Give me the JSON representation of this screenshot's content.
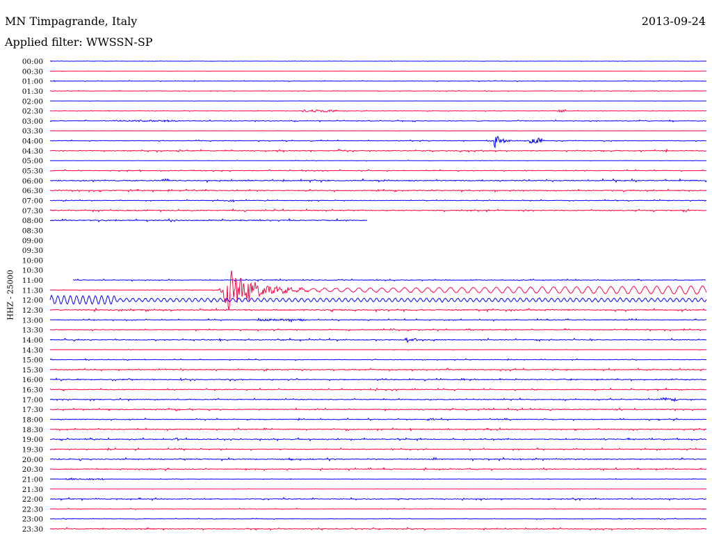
{
  "header": {
    "station": "MN Timpagrande, Italy",
    "filter": "Applied filter: WWSSN-SP",
    "date": "2013-09-24"
  },
  "chart_data": {
    "type": "line",
    "title": "MN Timpagrande, Italy",
    "subtitle": "Applied filter: WWSSN-SP",
    "ylabel": "HHZ - 25000",
    "x_unit": "minutes within row",
    "xlim": [
      0,
      30
    ],
    "colors": {
      "blue": "#0000ff",
      "red": "#ff0040"
    },
    "rows": [
      {
        "label": "00:00",
        "color": "blue",
        "start": 0,
        "end": 30,
        "noise": 0.2,
        "events": []
      },
      {
        "label": "00:30",
        "color": "red",
        "start": 0,
        "end": 30,
        "noise": 0.2,
        "events": []
      },
      {
        "label": "01:00",
        "color": "blue",
        "start": 0,
        "end": 30,
        "noise": 0.5,
        "events": []
      },
      {
        "label": "01:30",
        "color": "red",
        "start": 0,
        "end": 30,
        "noise": 0.4,
        "events": []
      },
      {
        "label": "02:00",
        "color": "blue",
        "start": 0,
        "end": 30,
        "noise": 0.2,
        "events": []
      },
      {
        "label": "02:30",
        "color": "red",
        "start": 0,
        "end": 30,
        "noise": 0.4,
        "events": [
          {
            "t": 11.5,
            "dur": 1.6,
            "amp": 1.5
          },
          {
            "t": 23.2,
            "dur": 0.4,
            "amp": 2
          }
        ]
      },
      {
        "label": "03:00",
        "color": "blue",
        "start": 0,
        "end": 30,
        "noise": 0.7,
        "events": [
          {
            "t": 3,
            "dur": 3,
            "amp": 1
          }
        ]
      },
      {
        "label": "03:30",
        "color": "red",
        "start": 0,
        "end": 30,
        "noise": 0.2,
        "events": []
      },
      {
        "label": "04:00",
        "color": "blue",
        "start": 0,
        "end": 30,
        "noise": 0.6,
        "events": [
          {
            "t": 20.3,
            "dur": 3.5,
            "amp": 16,
            "shape": "impulse"
          },
          {
            "t": 21.9,
            "dur": 0.6,
            "amp": 4
          }
        ]
      },
      {
        "label": "04:30",
        "color": "red",
        "start": 0,
        "end": 30,
        "noise": 1,
        "events": []
      },
      {
        "label": "05:00",
        "color": "blue",
        "start": 0,
        "end": 30,
        "noise": 0.3,
        "events": []
      },
      {
        "label": "05:30",
        "color": "red",
        "start": 0,
        "end": 30,
        "noise": 0.7,
        "events": []
      },
      {
        "label": "06:00",
        "color": "blue",
        "start": 0,
        "end": 30,
        "noise": 1.2,
        "events": []
      },
      {
        "label": "06:30",
        "color": "red",
        "start": 0,
        "end": 30,
        "noise": 1,
        "events": []
      },
      {
        "label": "07:00",
        "color": "blue",
        "start": 0,
        "end": 30,
        "noise": 0.6,
        "events": [
          {
            "t": 8.1,
            "dur": 0.3,
            "amp": 2
          }
        ]
      },
      {
        "label": "07:30",
        "color": "red",
        "start": 0,
        "end": 30,
        "noise": 1,
        "events": []
      },
      {
        "label": "08:00",
        "color": "blue",
        "start": 0,
        "end": 14.5,
        "noise": 1.1,
        "events": []
      },
      {
        "label": "08:30",
        "color": "red",
        "start": null,
        "end": null,
        "noise": 0,
        "events": []
      },
      {
        "label": "09:00",
        "color": "blue",
        "start": null,
        "end": null,
        "noise": 0,
        "events": []
      },
      {
        "label": "09:30",
        "color": "red",
        "start": null,
        "end": null,
        "noise": 0,
        "events": []
      },
      {
        "label": "10:00",
        "color": "blue",
        "start": null,
        "end": null,
        "noise": 0,
        "events": []
      },
      {
        "label": "10:30",
        "color": "red",
        "start": null,
        "end": null,
        "noise": 0,
        "events": []
      },
      {
        "label": "11:00",
        "color": "blue",
        "start": 1.05,
        "end": 30,
        "noise": 0.8,
        "events": []
      },
      {
        "label": "11:30",
        "color": "red",
        "start": 0,
        "end": 30,
        "noise": 0.4,
        "events": [
          {
            "t": 7.7,
            "dur": 22.3,
            "amp": 30,
            "shape": "quake"
          }
        ]
      },
      {
        "label": "12:00",
        "color": "blue",
        "start": 0,
        "end": 30,
        "noise": 0.5,
        "events": [
          {
            "t": 0,
            "dur": 30,
            "amp": 6,
            "shape": "surface"
          }
        ]
      },
      {
        "label": "12:30",
        "color": "red",
        "start": 0,
        "end": 30,
        "noise": 1.2,
        "events": []
      },
      {
        "label": "13:00",
        "color": "blue",
        "start": 0,
        "end": 30,
        "noise": 0.8,
        "events": [
          {
            "t": 9.5,
            "dur": 2.2,
            "amp": 1.5
          }
        ]
      },
      {
        "label": "13:30",
        "color": "red",
        "start": 0,
        "end": 30,
        "noise": 0.8,
        "events": []
      },
      {
        "label": "14:00",
        "color": "blue",
        "start": 0,
        "end": 30,
        "noise": 1,
        "events": [
          {
            "t": 16.2,
            "dur": 0.6,
            "amp": 2
          }
        ]
      },
      {
        "label": "14:30",
        "color": "red",
        "start": 0,
        "end": 30,
        "noise": 0.3,
        "events": []
      },
      {
        "label": "15:00",
        "color": "blue",
        "start": 0,
        "end": 30,
        "noise": 0.6,
        "events": []
      },
      {
        "label": "15:30",
        "color": "red",
        "start": 0,
        "end": 30,
        "noise": 1,
        "events": []
      },
      {
        "label": "16:00",
        "color": "blue",
        "start": 0,
        "end": 30,
        "noise": 1,
        "events": []
      },
      {
        "label": "16:30",
        "color": "red",
        "start": 0,
        "end": 30,
        "noise": 0.9,
        "events": []
      },
      {
        "label": "17:00",
        "color": "blue",
        "start": 0,
        "end": 30,
        "noise": 1,
        "events": [
          {
            "t": 27.9,
            "dur": 0.8,
            "amp": 2
          }
        ]
      },
      {
        "label": "17:30",
        "color": "red",
        "start": 0,
        "end": 30,
        "noise": 1,
        "events": []
      },
      {
        "label": "18:00",
        "color": "blue",
        "start": 0,
        "end": 30,
        "noise": 0.9,
        "events": [
          {
            "t": 17.2,
            "dur": 0.5,
            "amp": 1.5
          }
        ]
      },
      {
        "label": "18:30",
        "color": "red",
        "start": 0,
        "end": 30,
        "noise": 1,
        "events": []
      },
      {
        "label": "19:00",
        "color": "blue",
        "start": 0,
        "end": 30,
        "noise": 1,
        "events": []
      },
      {
        "label": "19:30",
        "color": "red",
        "start": 0,
        "end": 30,
        "noise": 0.9,
        "events": []
      },
      {
        "label": "20:00",
        "color": "blue",
        "start": 0,
        "end": 30,
        "noise": 1.1,
        "events": []
      },
      {
        "label": "20:30",
        "color": "red",
        "start": 0,
        "end": 30,
        "noise": 1,
        "events": []
      },
      {
        "label": "21:00",
        "color": "blue",
        "start": 0,
        "end": 30,
        "noise": 0.4,
        "events": [
          {
            "t": 0.7,
            "dur": 1.8,
            "amp": 1
          }
        ]
      },
      {
        "label": "21:30",
        "color": "red",
        "start": 0,
        "end": 30,
        "noise": 0.2,
        "events": []
      },
      {
        "label": "22:00",
        "color": "blue",
        "start": 0,
        "end": 30,
        "noise": 1,
        "events": []
      },
      {
        "label": "22:30",
        "color": "red",
        "start": 0,
        "end": 30,
        "noise": 0.5,
        "events": []
      },
      {
        "label": "23:00",
        "color": "blue",
        "start": 0,
        "end": 30,
        "noise": 0.5,
        "events": []
      },
      {
        "label": "23:30",
        "color": "red",
        "start": 0,
        "end": 30,
        "noise": 1,
        "events": []
      }
    ]
  }
}
